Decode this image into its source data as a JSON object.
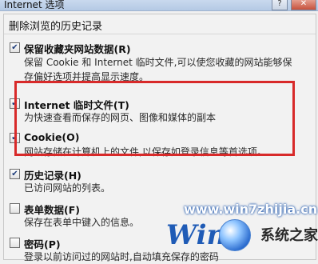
{
  "window": {
    "title": "Internet 选项",
    "help_label": "?",
    "close_label": "✕"
  },
  "dialog": {
    "title": "删除浏览的历史记录"
  },
  "items": [
    {
      "checked": true,
      "label": "保留收藏夹网站数据(R)",
      "desc": "保留 Cookie 和 Internet 临时文件,可以使您收藏的网站能够保存偏好选项并提高显示速度。"
    },
    {
      "checked": true,
      "label": "Internet 临时文件(T)",
      "desc": "为快速查看而保存的网页、图像和媒体的副本"
    },
    {
      "checked": true,
      "label": "Cookie(O)",
      "desc": "网站存储在计算机上的文件,以保存如登录信息等首选项。"
    },
    {
      "checked": true,
      "label": "历史记录(H)",
      "desc": "已访问网站的列表。"
    },
    {
      "checked": false,
      "label": "表单数据(F)",
      "desc": "保存在表单中键入的信息。"
    },
    {
      "checked": false,
      "label": "密码(P)",
      "desc": "登录以前访问过的网站时,自动填充保存的密码"
    }
  ],
  "watermark": {
    "url": "www.win7zhijia.cn",
    "logo_text": "Win",
    "cn_text": "系统之家"
  },
  "colors": {
    "highlight": "#d82a2a",
    "accent": "#1f5bb6"
  }
}
